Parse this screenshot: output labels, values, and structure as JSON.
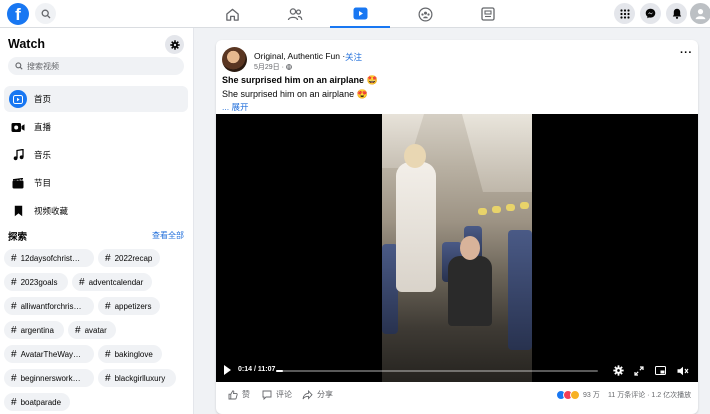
{
  "topbar": {
    "logo": "f",
    "nav": [
      {
        "name": "home-icon",
        "active": false
      },
      {
        "name": "friends-icon",
        "active": false
      },
      {
        "name": "watch-icon",
        "active": true
      },
      {
        "name": "groups-icon",
        "active": false
      },
      {
        "name": "gaming-icon",
        "active": false
      }
    ],
    "right": [
      "menu-grid-icon",
      "messenger-icon",
      "notifications-icon",
      "account-avatar-icon"
    ]
  },
  "sidebar": {
    "title": "Watch",
    "search_placeholder": "搜索视频",
    "items": [
      {
        "label": "首页",
        "icon": "watch-home-icon",
        "active": true
      },
      {
        "label": "直播",
        "icon": "live-icon",
        "active": false
      },
      {
        "label": "音乐",
        "icon": "music-icon",
        "active": false
      },
      {
        "label": "节目",
        "icon": "shows-icon",
        "active": false
      },
      {
        "label": "视频收藏",
        "icon": "saved-icon",
        "active": false
      }
    ],
    "explore": {
      "title": "探索",
      "see_all": "查看全部",
      "tags": [
        "12daysofchrist…",
        "2022recap",
        "2023goals",
        "adventcalendar",
        "alliwantforchris…",
        "appetizers",
        "argentina",
        "avatar",
        "AvatarTheWay…",
        "bakinglove",
        "beginnerswork…",
        "blackgirlluxury",
        "boatparade"
      ]
    }
  },
  "post": {
    "author": "Original, Authentic Fun",
    "separator": "·",
    "follow": "关注",
    "date": "5月29日 · ",
    "video_title": "She surprised him on an airplane 🤩",
    "caption": "She surprised him on an airplane 😍",
    "expand": "... 展开",
    "player": {
      "time": "0:14 / 11:07",
      "progress": 0.021
    },
    "actions": {
      "like": "赞",
      "comment": "评论",
      "share": "分享"
    },
    "reactions": {
      "count": "93 万",
      "colors": [
        "#1877f2",
        "#f33e58",
        "#f7b125"
      ]
    },
    "stats": "11 万条评论 · 1.2 亿次播放"
  }
}
